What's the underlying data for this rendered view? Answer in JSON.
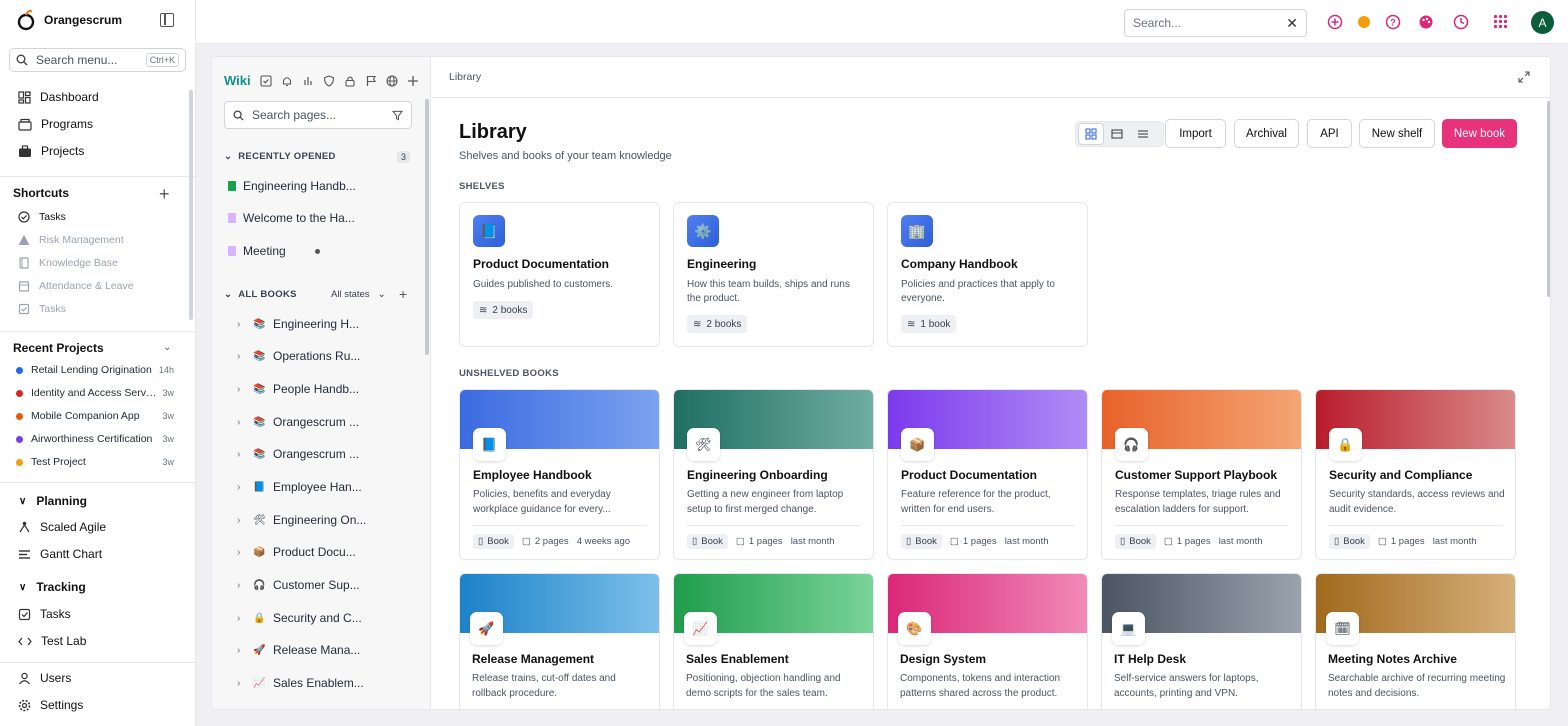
{
  "app": {
    "name": "Orangescrum"
  },
  "leftnav": {
    "search_placeholder": "Search menu...",
    "search_shortcut": "Ctrl+K",
    "main_items": [
      {
        "label": "Dashboard",
        "icon": "dashboard-icon"
      },
      {
        "label": "Programs",
        "icon": "programs-icon"
      },
      {
        "label": "Projects",
        "icon": "briefcase-icon"
      }
    ],
    "shortcuts_title": "Shortcuts",
    "shortcuts": [
      {
        "label": "Tasks",
        "icon": "check-circle-icon",
        "dim": false
      },
      {
        "label": "Risk Management",
        "icon": "warning-icon",
        "dim": true
      },
      {
        "label": "Knowledge Base",
        "icon": "book-icon",
        "dim": true
      },
      {
        "label": "Attendance & Leave",
        "icon": "calendar-icon",
        "dim": true
      },
      {
        "label": "Tasks",
        "icon": "checkbox-icon",
        "dim": true
      }
    ],
    "recent_title": "Recent Projects",
    "recent_projects": [
      {
        "name": "Retail Lending Origination",
        "age": "14h",
        "color": "#2563eb"
      },
      {
        "name": "Identity and Access Servi...",
        "age": "3w",
        "color": "#dc2626"
      },
      {
        "name": "Mobile Companion App",
        "age": "3w",
        "color": "#ea580c"
      },
      {
        "name": "Airworthiness Certification",
        "age": "3w",
        "color": "#7c3aed"
      },
      {
        "name": "Test Project",
        "age": "3w",
        "color": "#f59e0b"
      }
    ],
    "planning_title": "Planning",
    "planning": [
      {
        "label": "Scaled Agile"
      },
      {
        "label": "Gantt Chart"
      }
    ],
    "tracking_title": "Tracking",
    "tracking": [
      {
        "label": "Tasks"
      },
      {
        "label": "Test Lab"
      }
    ],
    "bottom": [
      {
        "label": "Users"
      },
      {
        "label": "Settings"
      }
    ]
  },
  "topbar": {
    "search_placeholder": "Search...",
    "avatar": "A"
  },
  "wiki": {
    "title": "Wiki",
    "search_placeholder": "Search pages...",
    "recent_title": "RECENTLY OPENED",
    "recent_count": "3",
    "recent": [
      {
        "label": "Engineering Handb...",
        "color": "#16a34a"
      },
      {
        "label": "Welcome to the Ha...",
        "color": "#d8b4fe"
      },
      {
        "label": "Meeting",
        "color": "#d8b4fe"
      }
    ],
    "all_title": "ALL BOOKS",
    "all_filter": "All states",
    "books": [
      {
        "label": "Engineering H...",
        "emoji": "📚"
      },
      {
        "label": "Operations Ru...",
        "emoji": "📚"
      },
      {
        "label": "People Handb...",
        "emoji": "📚"
      },
      {
        "label": "Orangescrum ...",
        "emoji": "📚"
      },
      {
        "label": "Orangescrum ...",
        "emoji": "📚"
      },
      {
        "label": "Employee Han...",
        "emoji": "📘"
      },
      {
        "label": "Engineering On...",
        "emoji": "🛠"
      },
      {
        "label": "Product Docu...",
        "emoji": "📦"
      },
      {
        "label": "Customer Sup...",
        "emoji": "🎧"
      },
      {
        "label": "Security and C...",
        "emoji": "🔒"
      },
      {
        "label": "Release Mana...",
        "emoji": "🚀"
      },
      {
        "label": "Sales Enablem...",
        "emoji": "📈"
      }
    ]
  },
  "content": {
    "breadcrumb": "Library",
    "title": "Library",
    "subtitle": "Shelves and books of your team knowledge",
    "buttons": {
      "import": "Import",
      "archival": "Archival",
      "api": "API",
      "new_shelf": "New shelf",
      "new_book": "New book"
    },
    "shelves_label": "SHELVES",
    "shelves": [
      {
        "title": "Product Documentation",
        "desc": "Guides published to customers.",
        "count": "2 books",
        "emoji": "📘"
      },
      {
        "title": "Engineering",
        "desc": "How this team builds, ships and runs the product.",
        "count": "2 books",
        "emoji": "⚙️"
      },
      {
        "title": "Company Handbook",
        "desc": "Policies and practices that apply to everyone.",
        "count": "1 book",
        "emoji": "🏢"
      }
    ],
    "unshelved_label": "UNSHELVED BOOKS",
    "books": [
      {
        "title": "Employee Handbook",
        "desc": "Policies, benefits and everyday workplace guidance for every...",
        "emoji": "📘",
        "c1": "#3b6be0",
        "c2": "#7ba3f0",
        "type": "Book",
        "pages": "2 pages",
        "when": "4 weeks ago"
      },
      {
        "title": "Engineering Onboarding",
        "desc": "Getting a new engineer from laptop setup to first merged change.",
        "emoji": "🛠",
        "c1": "#1f6f63",
        "c2": "#6fada2",
        "type": "Book",
        "pages": "1 pages",
        "when": "last month"
      },
      {
        "title": "Product Documentation",
        "desc": "Feature reference for the product, written for end users.",
        "emoji": "📦",
        "c1": "#7c3aed",
        "c2": "#b08cf5",
        "type": "Book",
        "pages": "1 pages",
        "when": "last month"
      },
      {
        "title": "Customer Support Playbook",
        "desc": "Response templates, triage rules and escalation ladders for support.",
        "emoji": "🎧",
        "c1": "#e8622a",
        "c2": "#f4a574",
        "type": "Book",
        "pages": "1 pages",
        "when": "last month"
      },
      {
        "title": "Security and Compliance",
        "desc": "Security standards, access reviews and audit evidence.",
        "emoji": "🔒",
        "c1": "#b91c2c",
        "c2": "#d98a8a",
        "type": "Book",
        "pages": "1 pages",
        "when": "last month"
      },
      {
        "title": "Release Management",
        "desc": "Release trains, cut-off dates and rollback procedure.",
        "emoji": "🚀",
        "c1": "#1c82c9",
        "c2": "#7cc0ea",
        "type": "",
        "pages": "",
        "when": ""
      },
      {
        "title": "Sales Enablement",
        "desc": "Positioning, objection handling and demo scripts for the sales team.",
        "emoji": "📈",
        "c1": "#1f9d4c",
        "c2": "#7ad39a",
        "type": "",
        "pages": "",
        "when": ""
      },
      {
        "title": "Design System",
        "desc": "Components, tokens and interaction patterns shared across the product.",
        "emoji": "🎨",
        "c1": "#db2777",
        "c2": "#f08ab8",
        "type": "",
        "pages": "",
        "when": ""
      },
      {
        "title": "IT Help Desk",
        "desc": "Self-service answers for laptops, accounts, printing and VPN.",
        "emoji": "💻",
        "c1": "#4b5563",
        "c2": "#9aa3ad",
        "type": "",
        "pages": "",
        "when": ""
      },
      {
        "title": "Meeting Notes Archive",
        "desc": "Searchable archive of recurring meeting notes and decisions.",
        "emoji": "🗓",
        "c1": "#a16a1e",
        "c2": "#d6b07a",
        "type": "",
        "pages": "",
        "when": ""
      }
    ]
  }
}
